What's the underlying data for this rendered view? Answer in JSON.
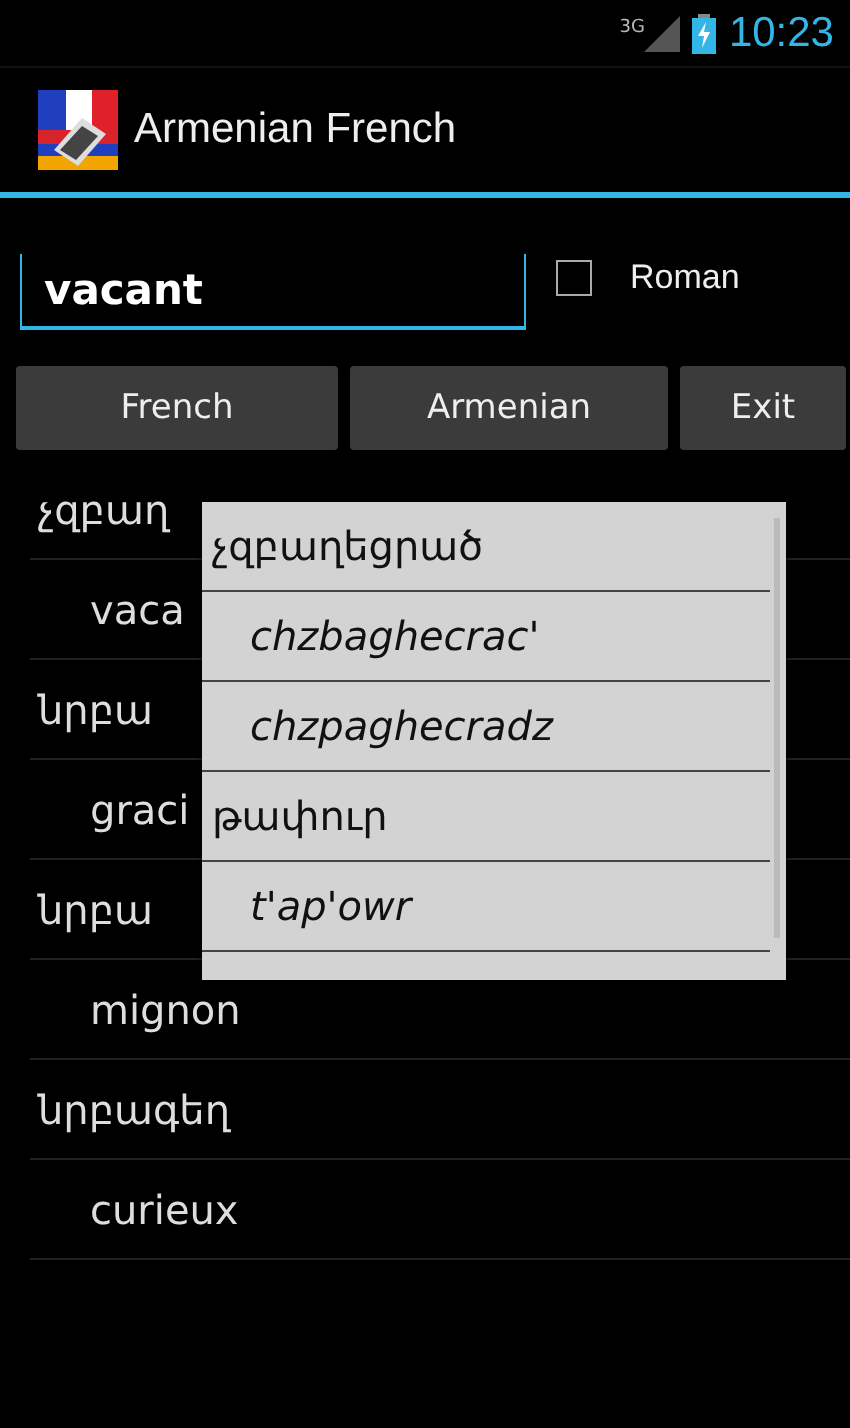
{
  "status_bar": {
    "network": "3G",
    "time": "10:23"
  },
  "action_bar": {
    "title": "Armenian French"
  },
  "search": {
    "value": "vacant"
  },
  "roman_option": {
    "label": "Roman",
    "checked": false
  },
  "buttons": [
    "French",
    "Armenian",
    "Exit"
  ],
  "list": [
    {
      "kind": "armenian",
      "text": "չզբաղ"
    },
    {
      "kind": "french",
      "text": "vaca"
    },
    {
      "kind": "armenian",
      "text": "նրբա"
    },
    {
      "kind": "french",
      "text": "graci"
    },
    {
      "kind": "armenian",
      "text": "նրբա"
    },
    {
      "kind": "french",
      "text": "mignon"
    },
    {
      "kind": "armenian",
      "text": "նրբագեղ"
    },
    {
      "kind": "french",
      "text": "curieux"
    }
  ],
  "suggestions": [
    {
      "kind": "armenian",
      "text": "չզբաղեցրած"
    },
    {
      "kind": "roman",
      "text": "chzbaghecrac'"
    },
    {
      "kind": "roman",
      "text": "chzpaghecradz"
    },
    {
      "kind": "armenian",
      "text": "թափուր"
    },
    {
      "kind": "roman",
      "text": "t'ap'owr"
    }
  ]
}
